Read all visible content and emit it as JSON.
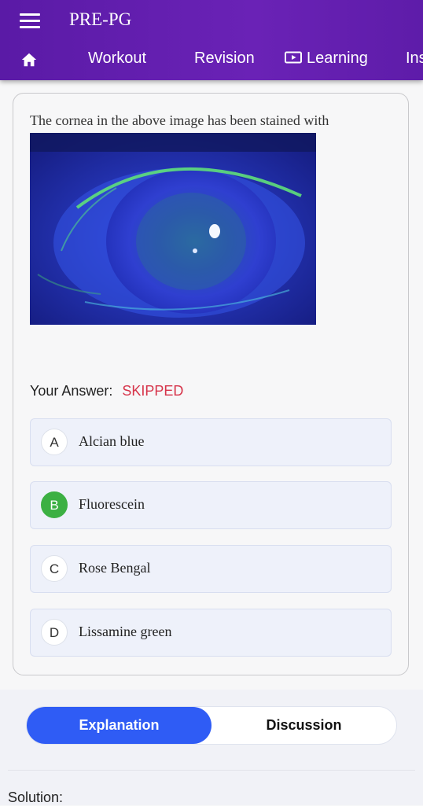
{
  "app": {
    "title": "PRE-PG"
  },
  "nav": {
    "items": [
      {
        "label": "Workout"
      },
      {
        "label": "Revision"
      },
      {
        "label": "Learning"
      },
      {
        "label": "Ins"
      }
    ]
  },
  "question": {
    "text": "The cornea in the above image has been stained with",
    "image": "eye-fluorescein-stain-image"
  },
  "answer": {
    "label": "Your Answer:",
    "status": "SKIPPED"
  },
  "options": [
    {
      "letter": "A",
      "text": "Alcian blue",
      "correct": false
    },
    {
      "letter": "B",
      "text": "Fluorescein",
      "correct": true
    },
    {
      "letter": "C",
      "text": "Rose Bengal",
      "correct": false
    },
    {
      "letter": "D",
      "text": "Lissamine green",
      "correct": false
    }
  ],
  "tabs": {
    "explanation": "Explanation",
    "discussion": "Discussion",
    "active": "Explanation"
  },
  "solution": {
    "label": "Solution:"
  },
  "colors": {
    "appbar": "#5a1aa6",
    "accent": "#2f5cf5",
    "correct": "#3cb043",
    "skipped": "#d6344a"
  }
}
